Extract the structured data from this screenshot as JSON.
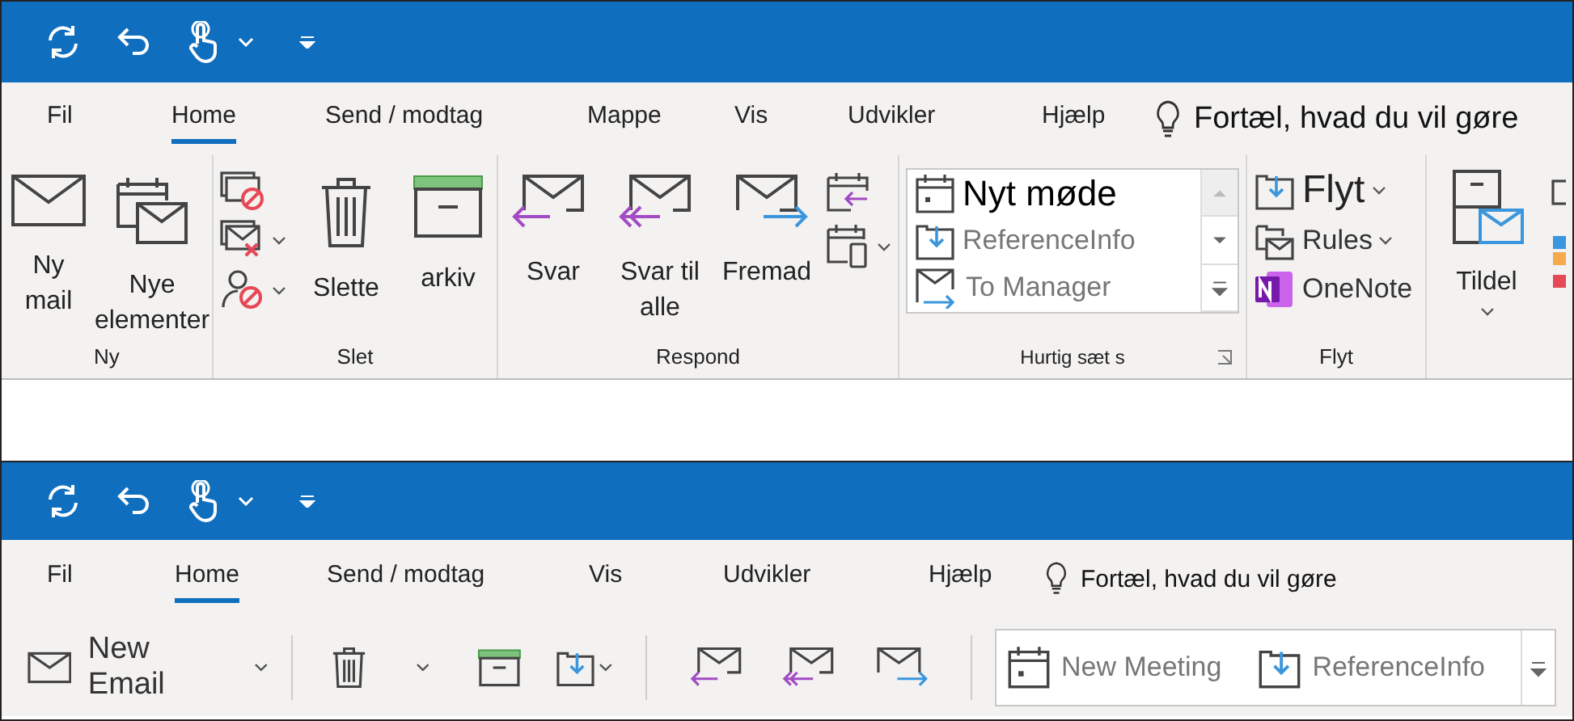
{
  "classic": {
    "tabs": [
      {
        "label": "Fil",
        "selected": false
      },
      {
        "label": "Home",
        "selected": true
      },
      {
        "label": "Send / modtag",
        "selected": false
      },
      {
        "label": "Mappe",
        "selected": false
      },
      {
        "label": "Vis",
        "selected": false
      },
      {
        "label": "Udvikler",
        "selected": false
      },
      {
        "label": "Hjælp",
        "selected": false
      }
    ],
    "tell_me": "Fortæl, hvad du vil gøre",
    "new_group": {
      "label": "Ny",
      "buttons": [
        "Ny mail",
        "Nye elementer"
      ]
    },
    "delete_group": {
      "label": "Slet",
      "buttons": [
        "Slette",
        "arkiv"
      ]
    },
    "respond_group": {
      "label": "Respond",
      "buttons": [
        "Svar",
        "Svar til alle",
        "Fremad"
      ]
    },
    "quick_steps": {
      "label": "Hurtig sæt s",
      "items": [
        {
          "label": "Nyt møde",
          "selected": true
        },
        {
          "label": "ReferenceInfo",
          "selected": false
        },
        {
          "label": "To Manager",
          "selected": false
        }
      ]
    },
    "move_group": {
      "label": "Flyt",
      "buttons": [
        "Flyt",
        "Rules",
        "OneNote"
      ]
    },
    "tags_group": {
      "buttons": [
        "Tildel"
      ]
    }
  },
  "simplified": {
    "tabs": [
      {
        "label": "Fil",
        "selected": false
      },
      {
        "label": "Home",
        "selected": true
      },
      {
        "label": "Send / modtag",
        "selected": false
      },
      {
        "label": "Vis",
        "selected": false
      },
      {
        "label": "Udvikler",
        "selected": false
      },
      {
        "label": "Hjælp",
        "selected": false
      }
    ],
    "tell_me": "Fortæl, hvad du vil gøre",
    "new_email": "New Email",
    "quick_steps": {
      "items": [
        {
          "label": "New Meeting",
          "selected": false
        },
        {
          "label": "ReferenceInfo",
          "selected": false
        }
      ]
    }
  }
}
